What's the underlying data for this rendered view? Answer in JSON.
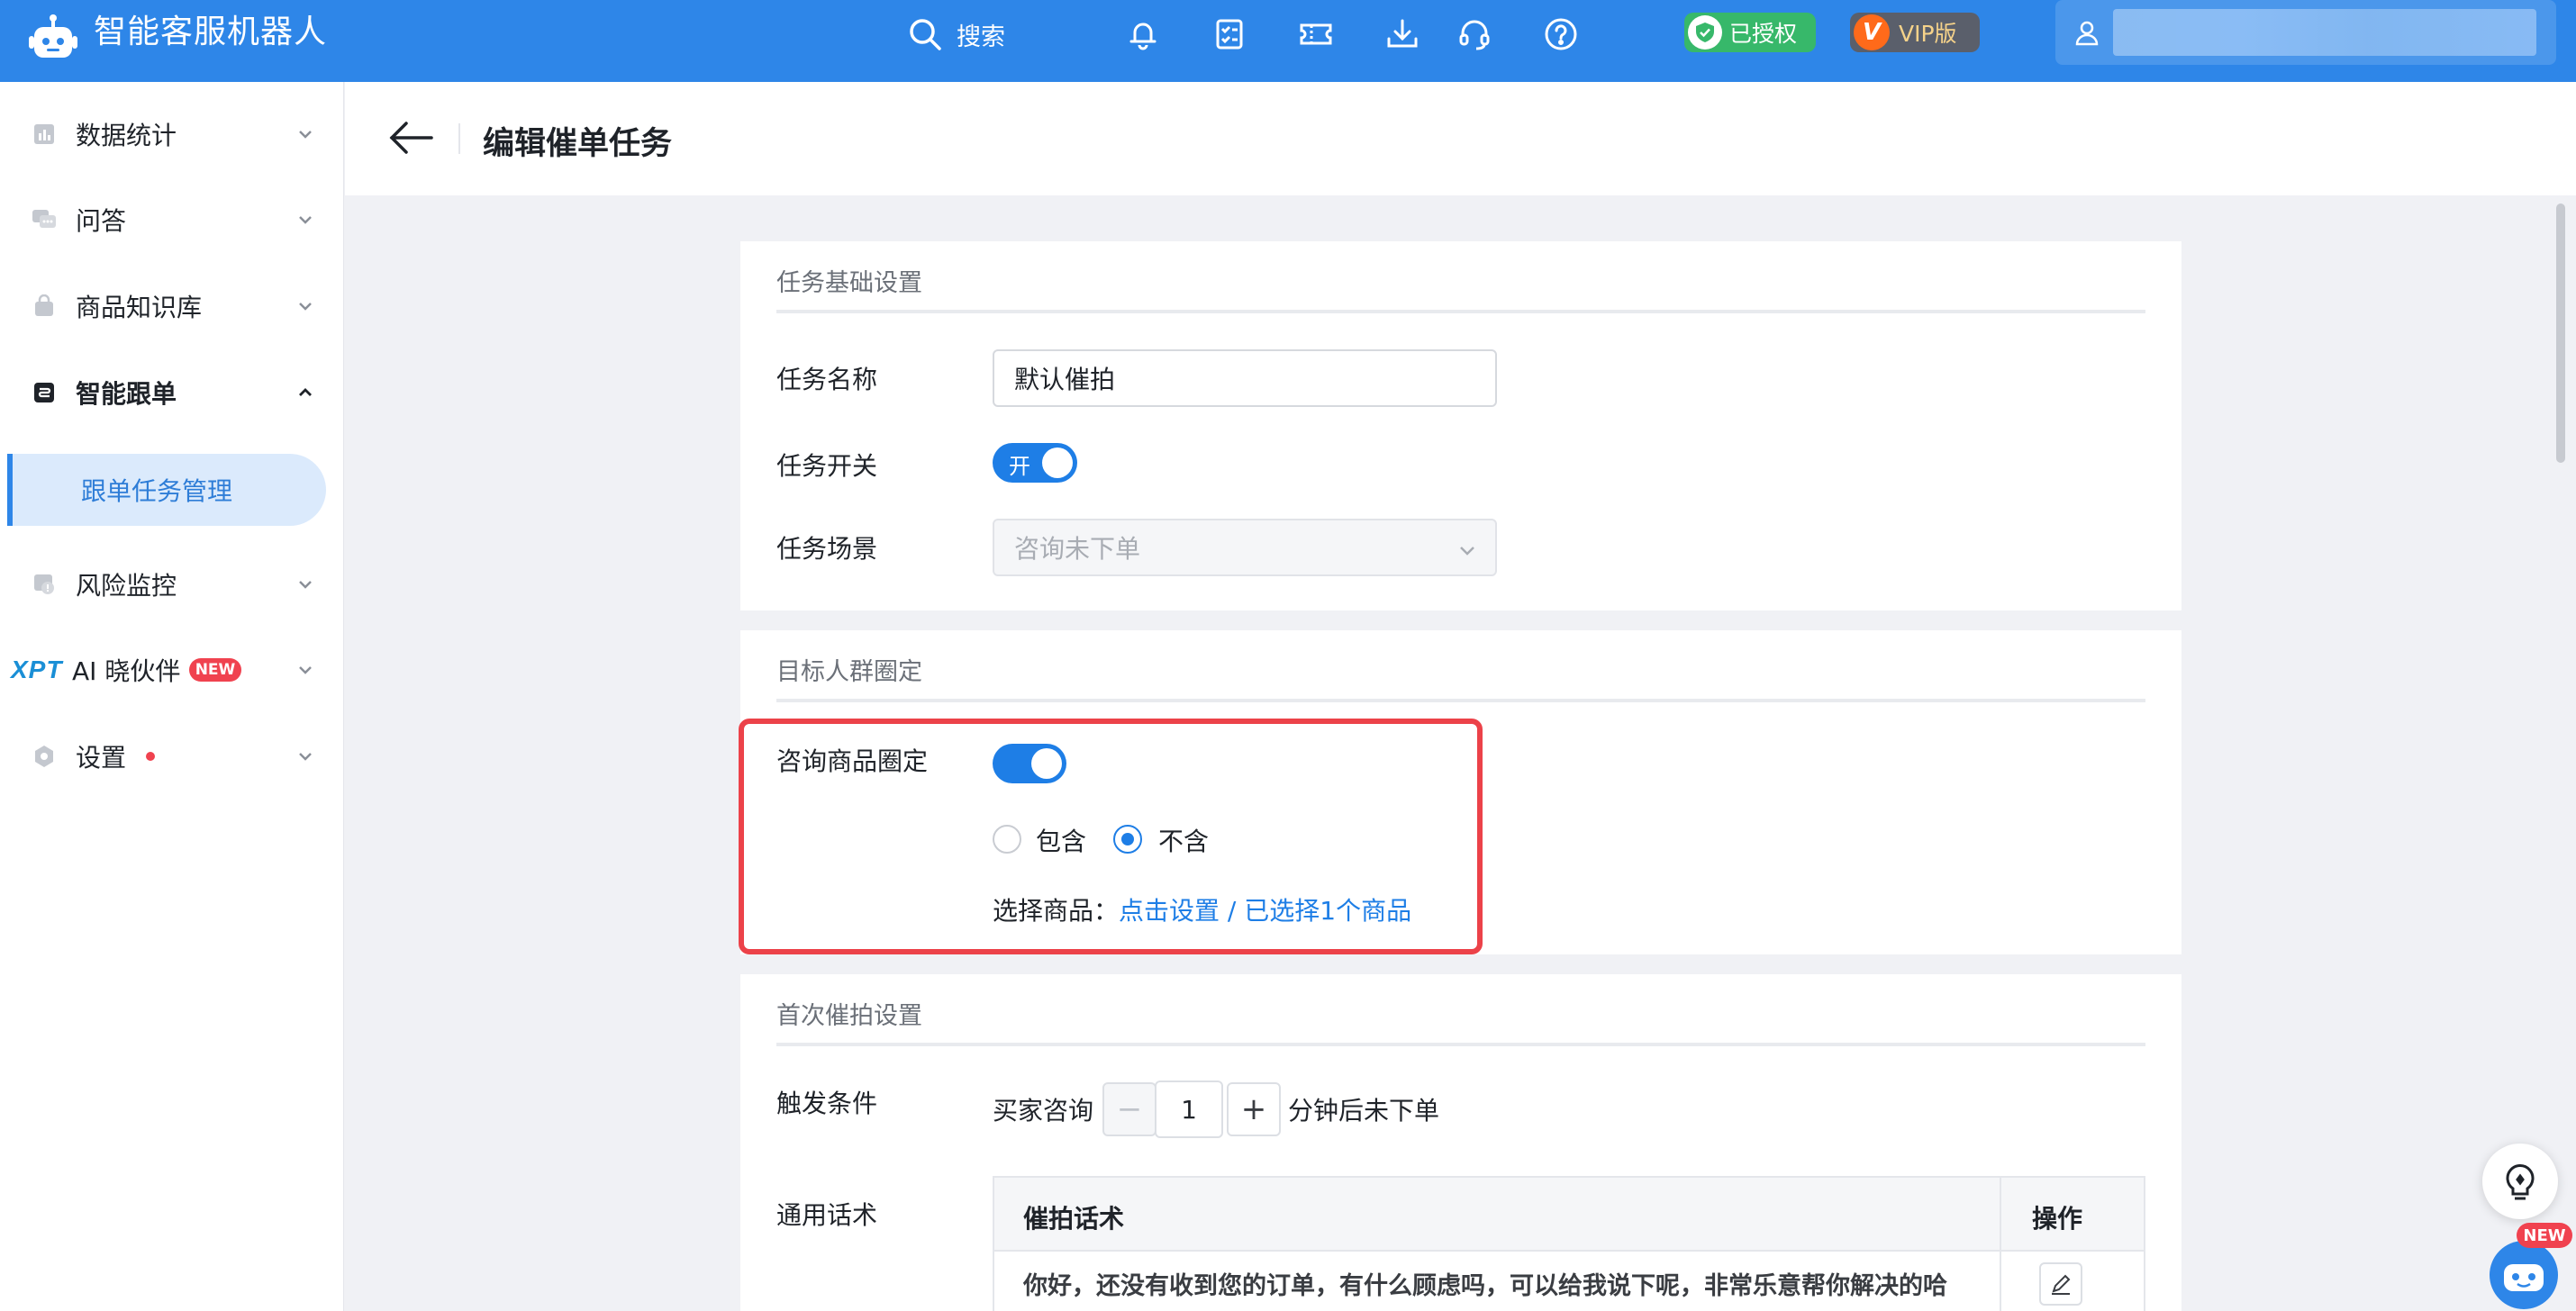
{
  "topbar": {
    "app_title": "智能客服机器人",
    "search_label": "搜索",
    "icons": [
      "bell-icon",
      "checklist-icon",
      "ticket-icon",
      "download-icon",
      "headset-icon",
      "help-icon"
    ],
    "auth_badge": "已授权",
    "vip_badge": "VIP版",
    "vip_letter": "V",
    "brand_color": "#2e86e8"
  },
  "sidebar": {
    "items": [
      {
        "label": "数据统计",
        "icon": "chart-icon"
      },
      {
        "label": "问答",
        "icon": "chat-icon"
      },
      {
        "label": "商品知识库",
        "icon": "bag-icon"
      },
      {
        "label": "智能跟单",
        "icon": "order-icon",
        "expanded": true
      },
      {
        "label": "风险监控",
        "icon": "risk-icon"
      },
      {
        "label": "AI 晓伙伴",
        "icon": "xpt-logo",
        "logo_text": "XPT",
        "badge": "NEW"
      },
      {
        "label": "设置",
        "icon": "settings-icon",
        "dot": true
      }
    ],
    "sub_item": "跟单任务管理"
  },
  "header": {
    "title": "编辑催单任务"
  },
  "basic": {
    "section_title": "任务基础设置",
    "name_label": "任务名称",
    "name_value": "默认催拍",
    "switch_label": "任务开关",
    "switch_text": "开",
    "scene_label": "任务场景",
    "scene_value": "咨询未下单"
  },
  "target": {
    "section_title": "目标人群圈定",
    "product_label": "咨询商品圈定",
    "include_label": "包含",
    "exclude_label": "不含",
    "selected_option": "不含",
    "choose_label": "选择商品：",
    "choose_link": "点击设置 / 已选择1个商品"
  },
  "first": {
    "section_title": "首次催拍设置",
    "trigger_label": "触发条件",
    "trigger_prefix": "买家咨询",
    "minus": "−",
    "plus": "+",
    "minutes": "1",
    "trigger_suffix": "分钟后未下单",
    "script_label": "通用话术",
    "table_col1": "催拍话术",
    "table_col2": "操作",
    "script_text": "你好，还没有收到您的订单，有什么顾虑吗，可以给我说下呢，非常乐意帮你解决的哈"
  },
  "floating": {
    "new_badge": "NEW"
  }
}
